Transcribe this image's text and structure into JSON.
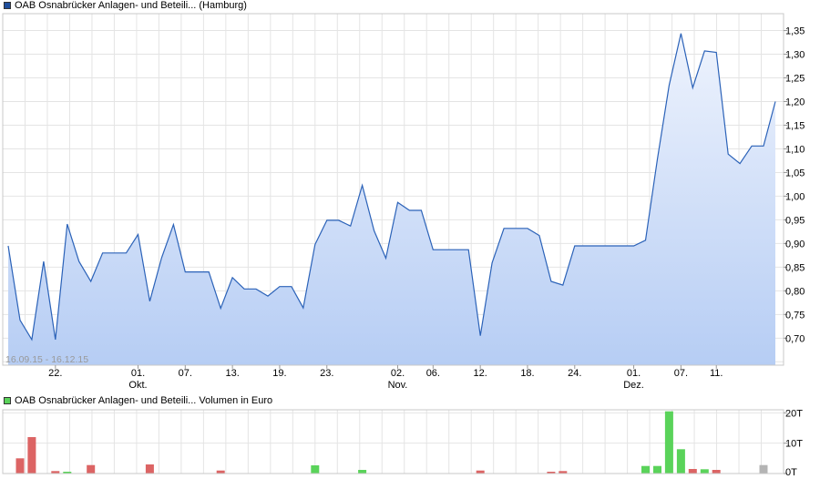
{
  "price_chart": {
    "legend_label": "OAB Osnabrücker Anlagen- und Beteili... (Hamburg)",
    "legend_color": "#1f4e9c",
    "line_color": "#2b62b8",
    "fill_top_color": "#eef3fd",
    "fill_bottom_color": "#b6cdf4",
    "date_range": "16.09.15 - 16.12.15",
    "month_labels": [
      "Okt.",
      "Nov.",
      "Dez."
    ]
  },
  "volume_chart": {
    "legend_label": "OAB Osnabrücker Anlagen- und Beteili... Volumen in Euro",
    "legend_color": "#5ad35a",
    "up_color": "#5ad35a",
    "down_color": "#dc6464",
    "neutral_color": "#b4b4b4"
  },
  "chart_data": [
    {
      "type": "area",
      "series": [
        {
          "name": "OAB Osnabrücker Anlagen- und Beteili... (Hamburg)",
          "values": [
            0.895,
            0.738,
            0.697,
            0.862,
            0.697,
            0.941,
            0.862,
            0.82,
            0.88,
            0.88,
            0.88,
            0.919,
            0.778,
            0.87,
            0.94,
            0.84,
            0.84,
            0.84,
            0.763,
            0.828,
            0.804,
            0.804,
            0.789,
            0.809,
            0.809,
            0.764,
            0.898,
            0.949,
            0.949,
            0.937,
            1.023,
            0.927,
            0.869,
            0.987,
            0.97,
            0.97,
            0.887,
            0.887,
            0.887,
            0.887,
            0.705,
            0.859,
            0.932,
            0.932,
            0.932,
            0.917,
            0.82,
            0.812,
            0.895,
            0.895,
            0.895,
            0.895,
            0.895,
            0.895,
            0.907,
            1.078,
            1.234,
            1.344,
            1.229,
            1.307,
            1.304,
            1.089,
            1.069,
            1.106,
            1.106,
            1.2
          ]
        }
      ],
      "x_tick_labels": [
        "22.",
        "01.",
        "07.",
        "13.",
        "19.",
        "23.",
        "02.",
        "06.",
        "12.",
        "18.",
        "24.",
        "01.",
        "07.",
        "11."
      ],
      "y_tick_labels": [
        "0,70",
        "0,75",
        "0,80",
        "0,85",
        "0,90",
        "0,95",
        "1,00",
        "1,05",
        "1,10",
        "1,15",
        "1,20",
        "1,25",
        "1,30",
        "1,35"
      ],
      "y_ticks": [
        0.7,
        0.75,
        0.8,
        0.85,
        0.9,
        0.95,
        1.0,
        1.05,
        1.1,
        1.15,
        1.2,
        1.25,
        1.3,
        1.35
      ],
      "ylim": [
        0.6429,
        1.3857
      ],
      "grid": true
    },
    {
      "type": "bar",
      "series": [
        {
          "name": "Volumen in Euro",
          "values": [
            0,
            0,
            5,
            12,
            0,
            0.8,
            0.5,
            0,
            0,
            2.8,
            0,
            0,
            0,
            0,
            0,
            0,
            3,
            0,
            0,
            0,
            0,
            0,
            0,
            0,
            1,
            0,
            0,
            0,
            0,
            0,
            0,
            0,
            0,
            0,
            0,
            0,
            0,
            0,
            0,
            0,
            0,
            0,
            0,
            0,
            0,
            0,
            0,
            0,
            0,
            0,
            0,
            0,
            0,
            0,
            2.6,
            0,
            0,
            0,
            0,
            0,
            0,
            1.2,
            0,
            0,
            0,
            0,
            0,
            0,
            0,
            0,
            0,
            0,
            0,
            0,
            0,
            0,
            0,
            0,
            0,
            0,
            0,
            0,
            1,
            0,
            0,
            0,
            0,
            0,
            0,
            0,
            0,
            0,
            0,
            0,
            0,
            0,
            0,
            0,
            0,
            0,
            0,
            0,
            0,
            0,
            0,
            0,
            0,
            0,
            0,
            0,
            0,
            0,
            0,
            0,
            0,
            0,
            0,
            0,
            0,
            0,
            0,
            0,
            0,
            0,
            0,
            0,
            0,
            0,
            0,
            0,
            0,
            0,
            0,
            0,
            0,
            0,
            0,
            0,
            0,
            0,
            0,
            0,
            0,
            0,
            0,
            0,
            0,
            0,
            0,
            0,
            0,
            0,
            0,
            0,
            0,
            0,
            0,
            0,
            0,
            0,
            0,
            0,
            0,
            0,
            0,
            0,
            0,
            0,
            0,
            0,
            0,
            0,
            0,
            0,
            0,
            0,
            0,
            0,
            0,
            0,
            0,
            0,
            0,
            0
          ]
        }
      ],
      "bars": [
        {
          "day": 1,
          "value": 5.0,
          "dir": "down"
        },
        {
          "day": 2,
          "value": 12.0,
          "dir": "down"
        },
        {
          "day": 4,
          "value": 0.8,
          "dir": "down"
        },
        {
          "day": 5,
          "value": 0.6,
          "dir": "up"
        },
        {
          "day": 7,
          "value": 2.8,
          "dir": "down"
        },
        {
          "day": 12,
          "value": 3.0,
          "dir": "down"
        },
        {
          "day": 18,
          "value": 1.0,
          "dir": "down"
        },
        {
          "day": 26,
          "value": 2.7,
          "dir": "up"
        },
        {
          "day": 30,
          "value": 1.2,
          "dir": "up"
        },
        {
          "day": 40,
          "value": 1.0,
          "dir": "down"
        },
        {
          "day": 46,
          "value": 0.6,
          "dir": "down"
        },
        {
          "day": 47,
          "value": 0.8,
          "dir": "down"
        },
        {
          "day": 54,
          "value": 2.5,
          "dir": "up"
        },
        {
          "day": 55,
          "value": 2.5,
          "dir": "up"
        },
        {
          "day": 56,
          "value": 20.5,
          "dir": "up"
        },
        {
          "day": 57,
          "value": 8.0,
          "dir": "up"
        },
        {
          "day": 58,
          "value": 1.5,
          "dir": "down"
        },
        {
          "day": 59,
          "value": 1.4,
          "dir": "up"
        },
        {
          "day": 60,
          "value": 1.2,
          "dir": "down"
        },
        {
          "day": 64,
          "value": 2.8,
          "dir": "neutral"
        }
      ],
      "y_tick_labels": [
        "0T",
        "10T",
        "20T"
      ],
      "y_ticks": [
        0,
        10,
        20
      ],
      "ylim": [
        0,
        21
      ],
      "grid": true
    }
  ]
}
